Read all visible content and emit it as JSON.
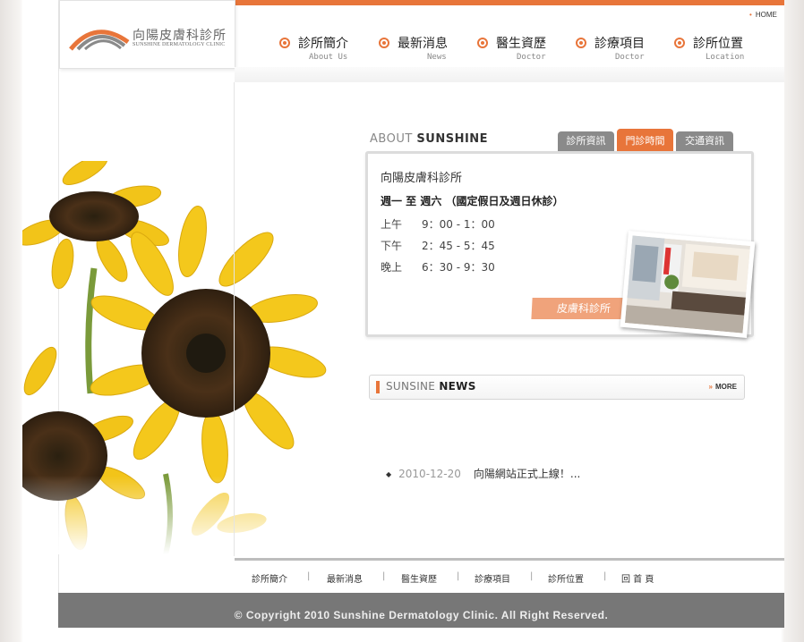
{
  "logo": {
    "name_cn": "向陽皮膚科診所",
    "name_en": "SUNSHINE DERMATOLOGY CLINIC"
  },
  "header": {
    "home_link": "HOME"
  },
  "nav": [
    {
      "zh": "診所簡介",
      "en": "About Us"
    },
    {
      "zh": "最新消息",
      "en": "News"
    },
    {
      "zh": "醫生資歷",
      "en": "Doctor"
    },
    {
      "zh": "診療項目",
      "en": "Doctor"
    },
    {
      "zh": "診所位置",
      "en": "Location"
    }
  ],
  "about": {
    "title_a": "ABOUT",
    "title_b": "SUNSHINE",
    "tabs": [
      {
        "label": "診所資訊",
        "active": false
      },
      {
        "label": "門診時間",
        "active": true
      },
      {
        "label": "交通資訊",
        "active": false
      }
    ],
    "clinic_name": "向陽皮膚科診所",
    "hours_heading": "週一 至 週六 （國定假日及週日休診）",
    "hours": [
      {
        "period": "上午",
        "time": "9：00 - 1：00"
      },
      {
        "period": "下午",
        "time": "2：45 - 5：45"
      },
      {
        "period": "晚上",
        "time": "6：30 - 9：30"
      }
    ],
    "photo_label": "皮膚科診所"
  },
  "news": {
    "title_a": "SUNSINE",
    "title_b": "NEWS",
    "more_label": "MORE",
    "items": [
      {
        "date": "2010-12-20",
        "title": "向陽網站正式上線！..."
      }
    ]
  },
  "footer": {
    "links": [
      "診所簡介",
      "最新消息",
      "醫生資歷",
      "診療項目",
      "診所位置",
      "回 首 頁"
    ],
    "separator": "|",
    "copyright": "© Copyright 2010 Sunshine Dermatology Clinic. All Right Reserved."
  },
  "colors": {
    "accent": "#e8753a",
    "tab_inactive": "#8a8a8a",
    "footer_bg": "#777777"
  }
}
